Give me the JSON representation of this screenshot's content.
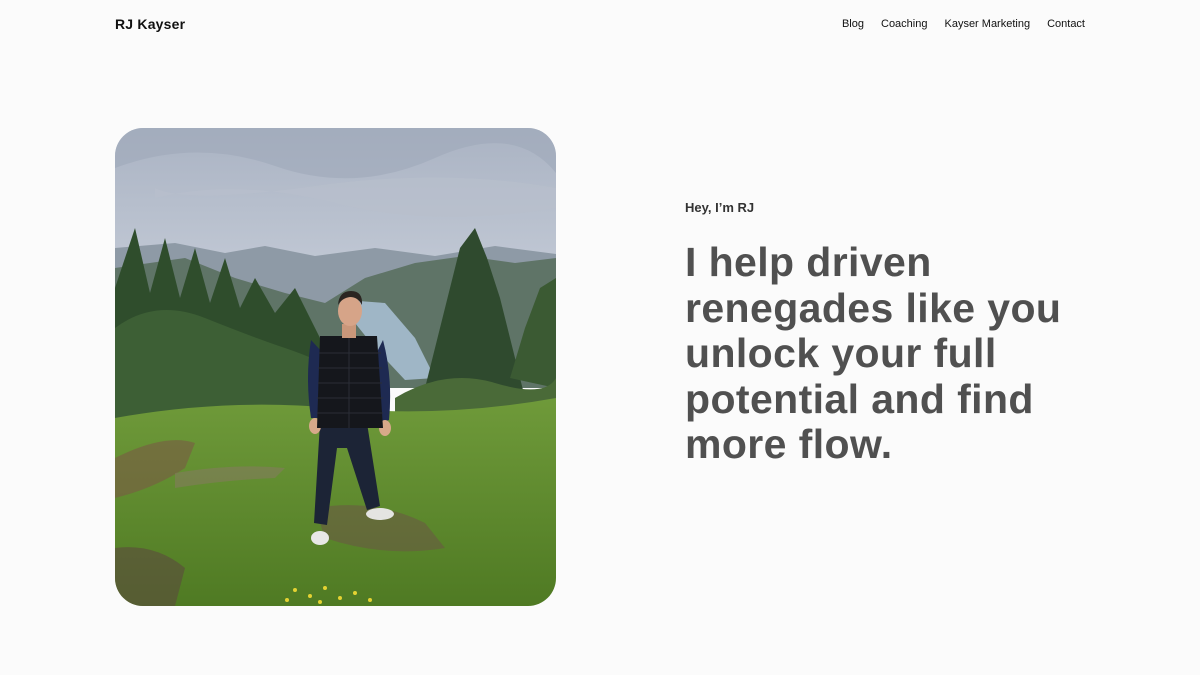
{
  "header": {
    "site_title": "RJ Kayser",
    "nav": [
      {
        "label": "Blog"
      },
      {
        "label": "Coaching"
      },
      {
        "label": "Kayser Marketing"
      },
      {
        "label": "Contact"
      }
    ]
  },
  "hero": {
    "eyebrow": "Hey, I’m RJ",
    "headline": "I help driven renegades like you unlock your full potential and find more flow."
  },
  "colors": {
    "background": "#fbfbfb",
    "headline": "#505050",
    "text": "#111111"
  }
}
